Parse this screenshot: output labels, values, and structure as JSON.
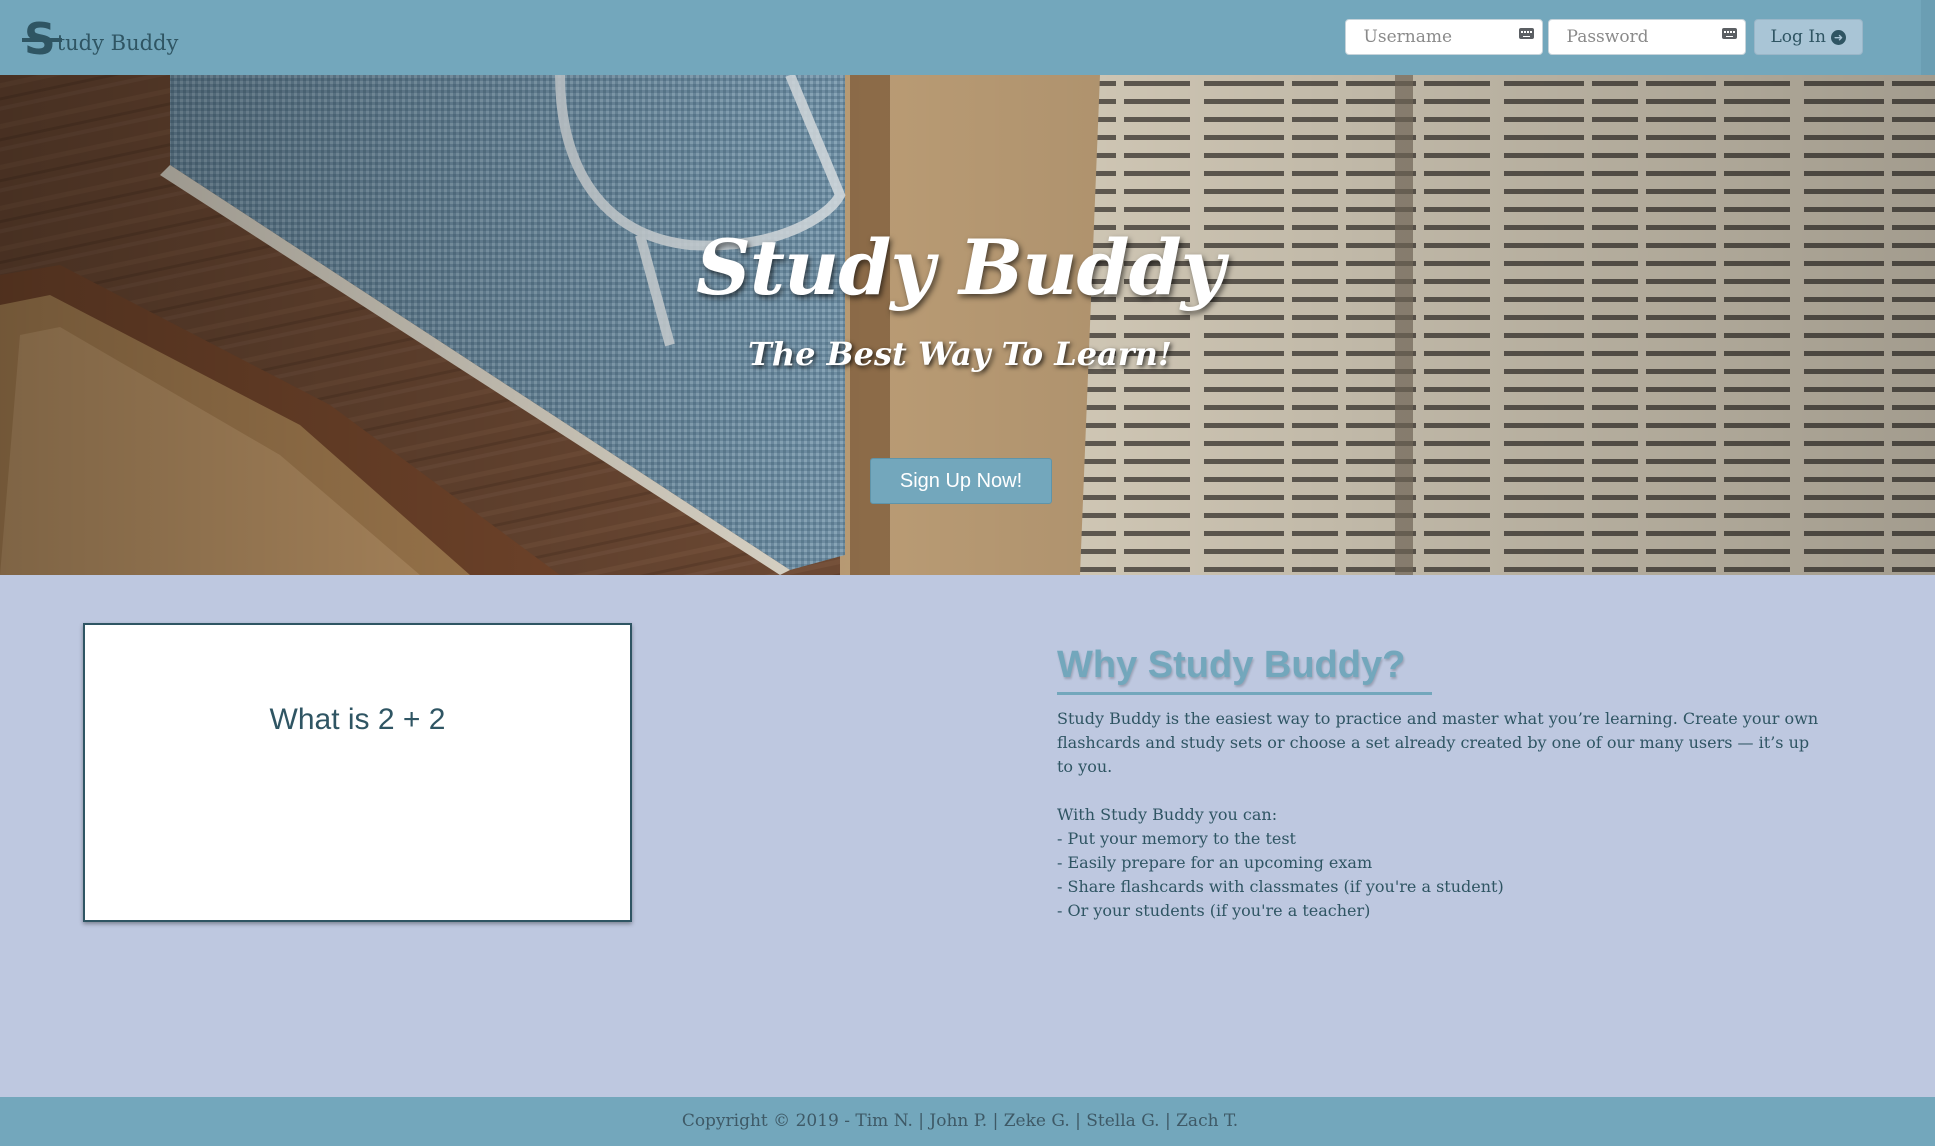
{
  "nav": {
    "brand_mark": "S",
    "brand_text": "tudy Buddy",
    "username_placeholder": "Username",
    "password_placeholder": "Password",
    "login_label": "Log In"
  },
  "hero": {
    "title": "Study Buddy",
    "subtitle": "The Best Way To Learn!",
    "cta_label": "Sign Up Now!"
  },
  "flashcard": {
    "question": "What is 2 + 2"
  },
  "why": {
    "heading": "Why Study Buddy?",
    "paragraph": "Study Buddy is the easiest way to practice and master what you’re learning. Create your own flashcards and study sets or choose a set already created by one of our many users — it’s up to you.",
    "intro": "With Study Buddy you can:",
    "items": [
      "- Put your memory to the test",
      "- Easily prepare for an upcoming exam",
      "- Share flashcards with classmates (if you're a student)",
      "- Or your students (if you're a teacher)"
    ]
  },
  "footer": {
    "text": "Copyright © 2019 - Tim N. | John P. | Zeke G. | Stella G. | Zach T."
  },
  "colors": {
    "nav": "#73a7bc",
    "page_background": "#bec8e0",
    "text_dark": "#2f5563",
    "accent": "#73a7bc"
  },
  "icons": {
    "login_button": "arrow-circle-right-icon",
    "password_manager": "key-icon"
  }
}
